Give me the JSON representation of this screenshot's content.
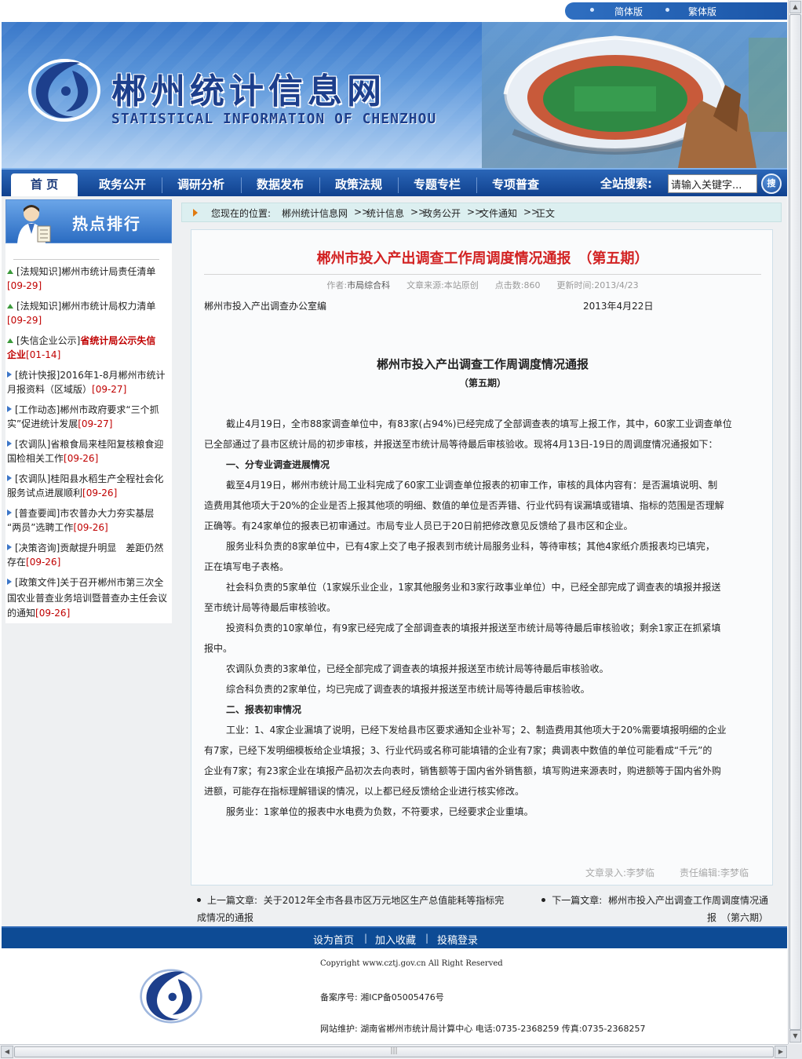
{
  "lang": {
    "simplified": "简体版",
    "traditional": "繁体版"
  },
  "header": {
    "title": "郴州统计信息网",
    "subtitle": "STATISTICAL INFORMATION OF CHENZHOU"
  },
  "nav": {
    "tabs": [
      {
        "label": "首 页",
        "active": true
      },
      {
        "label": "政务公开"
      },
      {
        "label": "调研分析"
      },
      {
        "label": "数据发布"
      },
      {
        "label": "政策法规"
      },
      {
        "label": "专题专栏"
      },
      {
        "label": "专项普查"
      }
    ],
    "search_label": "全站搜索:",
    "search_value": "请输入关键字...",
    "search_button": "搜"
  },
  "sidebar": {
    "title": "热点排行",
    "items": [
      {
        "l1": "[法规知识]郴州市统计局责任清单",
        "l2": "",
        "date": "[09-29]"
      },
      {
        "l1": "[法规知识]郴州市统计局权力清单",
        "l2": "",
        "date": "[09-29]"
      },
      {
        "l1": "[失信企业公示]",
        "hot1": "省统计局公示失信",
        "hot2": "企业",
        "date": "[01-14]"
      },
      {
        "l1": "[统计快报]2016年1-8月郴州市统计",
        "l2": "月报资料（区域版）",
        "date": "[09-27]"
      },
      {
        "l1": "[工作动态]郴州市政府要求“三个抓",
        "l2": "实”促进统计发展",
        "date": "[09-27]"
      },
      {
        "l1": "[农调队]省粮食局来桂阳复核粮食迎",
        "l2": "国检相关工作",
        "date": "[09-26]"
      },
      {
        "l1": "[农调队]桂阳县水稻生产全程社会化",
        "l2": "服务试点进展顺利",
        "date": "[09-26]"
      },
      {
        "l1": "[普查要闻]市农普办大力夯实基层",
        "l2": "“两员”选聘工作",
        "date": "[09-26]"
      },
      {
        "l1": "[决策咨询]贡献提升明显　差距仍然",
        "l2": "存在",
        "date": "[09-26]"
      },
      {
        "l1": "[政策文件]关于召开郴州市第三次全",
        "l2": "国农业普查业务培训暨普查办主任会议",
        "l3": "的通知",
        "date": "[09-26]"
      }
    ]
  },
  "breadcrumb": {
    "prefix": "您现在的位置:",
    "items": [
      "郴州统计信息网",
      "统计信息",
      "政务公开",
      "文件通知",
      "正文"
    ],
    "sep": ">>"
  },
  "article": {
    "title": "郴州市投入产出调查工作周调度情况通报　（第五期）",
    "meta": {
      "author_label": "作者:",
      "author": "市局综合科",
      "source_label": "文章来源:",
      "source": "本站原创",
      "hits_label": "点击数:",
      "hits": "860",
      "updated_label": "更新时间:",
      "updated": "2013/4/23"
    },
    "issuer": "郴州市投入产出调查办公室编",
    "issue_date": "2013年4月22日",
    "doc_title": "郴州市投入产出调查工作周调度情况通报",
    "doc_issue": "（第五期）",
    "para1a": "截止4月19日，全市88家调查单位中，有83家(占94%)已经完成了全部调查表的填写上报工作，其中，60家工业调查单位",
    "para1b": "已全部通过了县市区统计局的初步审核，并报送至市统计局等待最后审核验收。现将4月13日-19日的周调度情况通报如下：",
    "h1": "一、分专业调查进展情况",
    "para2a": "截至4月19日，郴州市统计局工业科完成了60家工业调查单位报表的初审工作，审核的具体内容有：是否漏填说明、制",
    "para2b": "造费用其他项大于20%的企业是否上报其他项的明细、数值的单位是否弄错、行业代码有误漏填或错填、指标的范围是否理解",
    "para2c": "正确等。有24家单位的报表已初审通过。市局专业人员已于20日前把修改意见反馈给了县市区和企业。",
    "para3a": "服务业科负责的8家单位中，已有4家上交了电子报表到市统计局服务业科，等待审核；其他4家纸介质报表均已填完，",
    "para3b": "正在填写电子表格。",
    "para4a": "社会科负责的5家单位（1家娱乐业企业，1家其他服务业和3家行政事业单位）中，已经全部完成了调查表的填报并报送",
    "para4b": "至市统计局等待最后审核验收。",
    "para5a": "投资科负责的10家单位，有9家已经完成了全部调查表的填报并报送至市统计局等待最后审核验收；剩余1家正在抓紧填",
    "para5b": "报中。",
    "para6": "农调队负责的3家单位，已经全部完成了调查表的填报并报送至市统计局等待最后审核验收。",
    "para7": "综合科负责的2家单位，均已完成了调查表的填报并报送至市统计局等待最后审核验收。",
    "h2": "二、报表初审情况",
    "para8a": "工业：1、4家企业漏填了说明，已经下发给县市区要求通知企业补写；2、制造费用其他项大于20%需要填报明细的企业",
    "para8b": "有7家，已经下发明细模板给企业填报；3、行业代码或名称可能填错的企业有7家；典调表中数值的单位可能看成“千元”的",
    "para8c": "企业有7家；有23家企业在填报产品初次去向表时，销售额等于国内省外销售额，填写购进来源表时，购进额等于国内省外购",
    "para8d": "进额，可能存在指标理解错误的情况，以上都已经反馈给企业进行核实修改。",
    "para9": "服务业：1家单位的报表中水电费为负数，不符要求，已经要求企业重填。",
    "entry_label": "文章录入:",
    "entry": "李梦临",
    "editor_label": "责任编辑:",
    "editor": "李梦临"
  },
  "prevnext": {
    "prev_label": "上一篇文章:",
    "prev_1": "关于2012年全市各县市区万元地区生产总值能耗等指标完",
    "prev_2": "成情况的通报",
    "next_label": "下一篇文章:",
    "next_1": "郴州市投入产出调查工作周调度情况通",
    "next_2": "报　（第六期）"
  },
  "footer": {
    "links": [
      "设为首页",
      "加入收藏",
      "投稿登录"
    ],
    "sep": "|",
    "copyright": "Copyright www.cztj.gov.cn All Right Reserved",
    "icp": "备案序号: 湘ICP备05005476号",
    "maint": "网站维护: 湖南省郴州市统计局计算中心 电话:0735-2368259 传真:0735-2368257"
  },
  "colors": {
    "nav_blue": "#10418e",
    "title_red": "#d22222",
    "date_red": "#c00000"
  }
}
